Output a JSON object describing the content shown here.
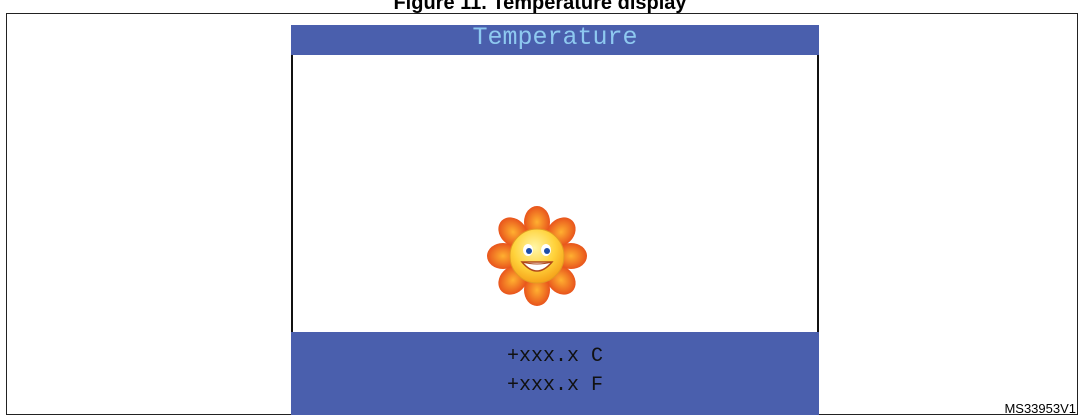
{
  "figure": {
    "title": "Figure 11. Temperature display",
    "reference": "MS33953V1"
  },
  "screen": {
    "header_title": "Temperature",
    "status_icon": "smiling-sun-icon",
    "readouts": {
      "celsius": "+xxx.x C",
      "fahrenheit": "+xxx.x F"
    }
  },
  "colors": {
    "bar_background": "#4a5fad",
    "header_text": "#8ec9f0",
    "readout_text": "#111111"
  }
}
